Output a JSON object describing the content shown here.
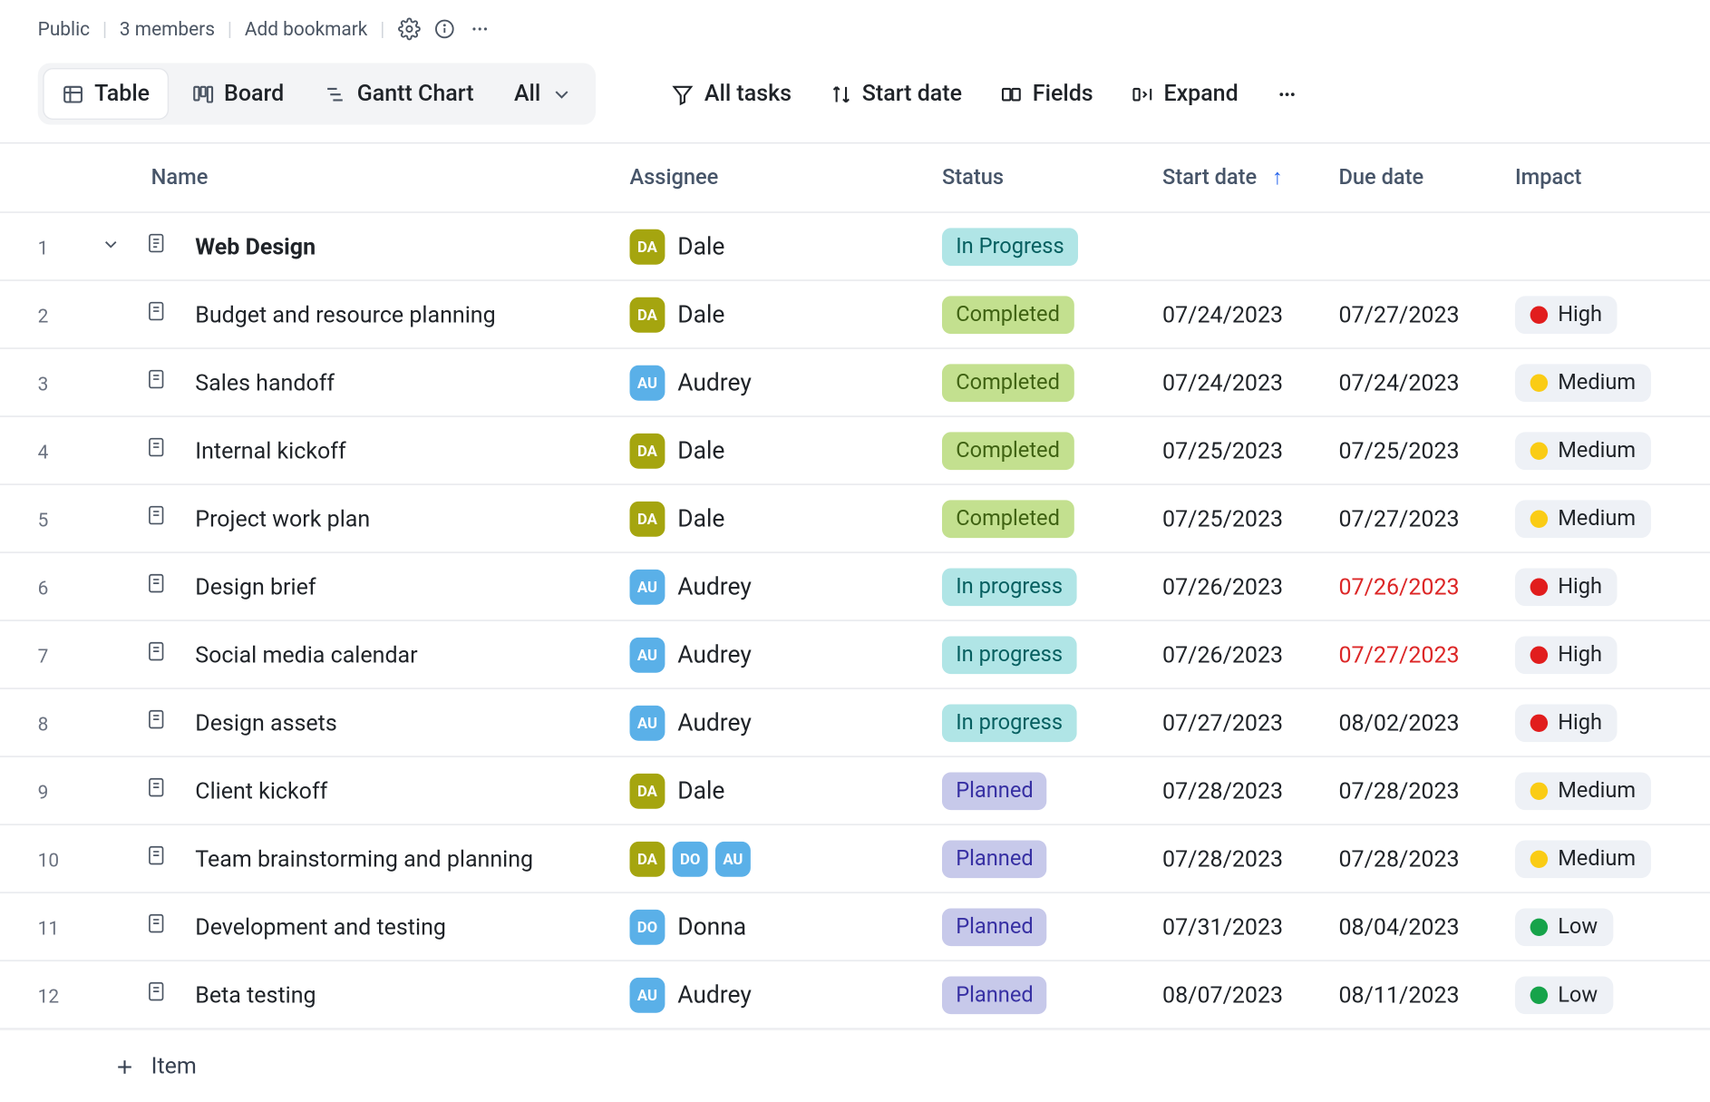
{
  "topbar": {
    "visibility": "Public",
    "members": "3 members",
    "add_bookmark": "Add bookmark"
  },
  "views": {
    "table": "Table",
    "board": "Board",
    "gantt": "Gantt Chart",
    "filter": "All"
  },
  "toolbar": {
    "all_tasks": "All tasks",
    "start_date": "Start date",
    "fields": "Fields",
    "expand": "Expand"
  },
  "columns": {
    "name": "Name",
    "assignee": "Assignee",
    "status": "Status",
    "start_date": "Start date",
    "due_date": "Due date",
    "impact": "Impact"
  },
  "rows": [
    {
      "num": "1",
      "parent": true,
      "name": "Web Design",
      "assignees": [
        {
          "initials": "DA"
        }
      ],
      "assignee_label": "Dale",
      "status": "In Progress",
      "status_class": "inprog",
      "start": "",
      "due": "",
      "impact": "",
      "impact_dot": ""
    },
    {
      "num": "2",
      "name": "Budget and resource planning",
      "assignees": [
        {
          "initials": "DA"
        }
      ],
      "assignee_label": "Dale",
      "status": "Completed",
      "status_class": "completed",
      "start": "07/24/2023",
      "due": "07/27/2023",
      "impact": "High",
      "impact_dot": "red"
    },
    {
      "num": "3",
      "name": "Sales handoff",
      "assignees": [
        {
          "initials": "AU"
        }
      ],
      "assignee_label": "Audrey",
      "status": "Completed",
      "status_class": "completed",
      "start": "07/24/2023",
      "due": "07/24/2023",
      "impact": "Medium",
      "impact_dot": "yellow"
    },
    {
      "num": "4",
      "name": "Internal kickoff",
      "assignees": [
        {
          "initials": "DA"
        }
      ],
      "assignee_label": "Dale",
      "status": "Completed",
      "status_class": "completed",
      "start": "07/25/2023",
      "due": "07/25/2023",
      "impact": "Medium",
      "impact_dot": "yellow"
    },
    {
      "num": "5",
      "name": "Project work plan",
      "assignees": [
        {
          "initials": "DA"
        }
      ],
      "assignee_label": "Dale",
      "status": "Completed",
      "status_class": "completed",
      "start": "07/25/2023",
      "due": "07/27/2023",
      "impact": "Medium",
      "impact_dot": "yellow"
    },
    {
      "num": "6",
      "name": "Design brief",
      "assignees": [
        {
          "initials": "AU"
        }
      ],
      "assignee_label": "Audrey",
      "status": "In progress",
      "status_class": "inprog",
      "start": "07/26/2023",
      "due": "07/26/2023",
      "due_overdue": true,
      "impact": "High",
      "impact_dot": "red"
    },
    {
      "num": "7",
      "name": "Social media calendar",
      "assignees": [
        {
          "initials": "AU"
        }
      ],
      "assignee_label": "Audrey",
      "status": "In progress",
      "status_class": "inprog",
      "start": "07/26/2023",
      "due": "07/27/2023",
      "due_overdue": true,
      "impact": "High",
      "impact_dot": "red"
    },
    {
      "num": "8",
      "name": "Design assets",
      "assignees": [
        {
          "initials": "AU"
        }
      ],
      "assignee_label": "Audrey",
      "status": "In progress",
      "status_class": "inprog",
      "start": "07/27/2023",
      "due": "08/02/2023",
      "impact": "High",
      "impact_dot": "red"
    },
    {
      "num": "9",
      "name": "Client kickoff",
      "assignees": [
        {
          "initials": "DA"
        }
      ],
      "assignee_label": "Dale",
      "status": "Planned",
      "status_class": "planned",
      "start": "07/28/2023",
      "due": "07/28/2023",
      "impact": "Medium",
      "impact_dot": "yellow"
    },
    {
      "num": "10",
      "name": "Team brainstorming and planning",
      "assignees": [
        {
          "initials": "DA"
        },
        {
          "initials": "DO"
        },
        {
          "initials": "AU"
        }
      ],
      "assignee_label": "",
      "status": "Planned",
      "status_class": "planned",
      "start": "07/28/2023",
      "due": "07/28/2023",
      "impact": "Medium",
      "impact_dot": "yellow"
    },
    {
      "num": "11",
      "name": "Development and testing",
      "assignees": [
        {
          "initials": "DO"
        }
      ],
      "assignee_label": "Donna",
      "status": "Planned",
      "status_class": "planned",
      "start": "07/31/2023",
      "due": "08/04/2023",
      "impact": "Low",
      "impact_dot": "green"
    },
    {
      "num": "12",
      "name": "Beta testing",
      "assignees": [
        {
          "initials": "AU"
        }
      ],
      "assignee_label": "Audrey",
      "status": "Planned",
      "status_class": "planned",
      "start": "08/07/2023",
      "due": "08/11/2023",
      "impact": "Low",
      "impact_dot": "green"
    }
  ],
  "footer": {
    "item": "Item"
  }
}
